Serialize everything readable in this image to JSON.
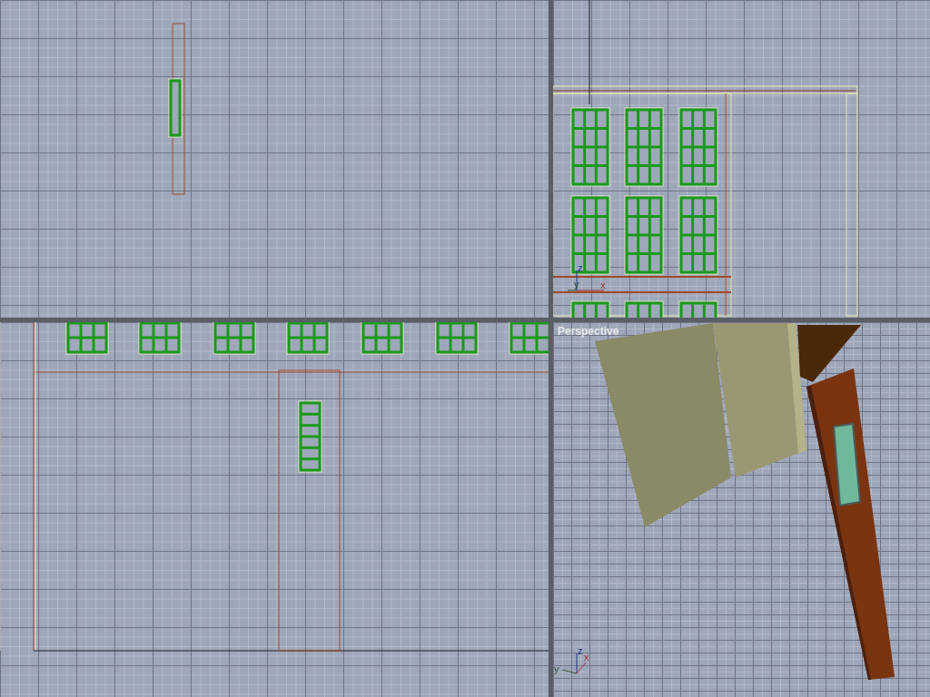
{
  "viewports": [
    {
      "kind": "top"
    },
    {
      "kind": "front",
      "axis": [
        "z",
        "y",
        "x"
      ]
    },
    {
      "kind": "left"
    },
    {
      "kind": "perspective",
      "label": "Perspective",
      "axis": [
        "z",
        "y",
        "x"
      ]
    }
  ]
}
